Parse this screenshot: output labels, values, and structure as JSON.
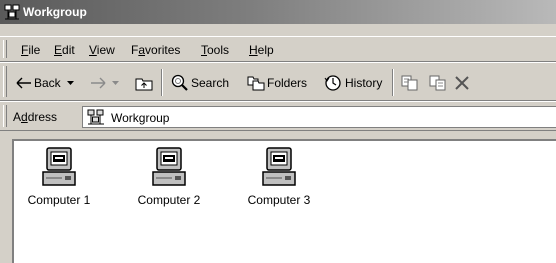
{
  "window": {
    "title": "Workgroup"
  },
  "menu": [
    {
      "label": "File",
      "key": "F",
      "rest": "ile"
    },
    {
      "label": "Edit",
      "key": "E",
      "rest": "dit"
    },
    {
      "label": "View",
      "key": "V",
      "rest": "iew"
    },
    {
      "label": "Favorites",
      "pre": "F",
      "key": "a",
      "rest": "vorites"
    },
    {
      "label": "Tools",
      "key": "T",
      "rest": "ools"
    },
    {
      "label": "Help",
      "key": "H",
      "rest": "elp"
    }
  ],
  "toolbar": {
    "back_label": "Back",
    "search_label": "Search",
    "folders_label": "Folders",
    "history_label": "History"
  },
  "address": {
    "label_pre": "A",
    "label_key": "d",
    "label_rest": "dress",
    "value": "Workgroup"
  },
  "items": [
    {
      "label": "Computer 1",
      "icon": "computer-icon"
    },
    {
      "label": "Computer 2",
      "icon": "computer-icon"
    },
    {
      "label": "Computer 3",
      "icon": "computer-icon"
    }
  ]
}
